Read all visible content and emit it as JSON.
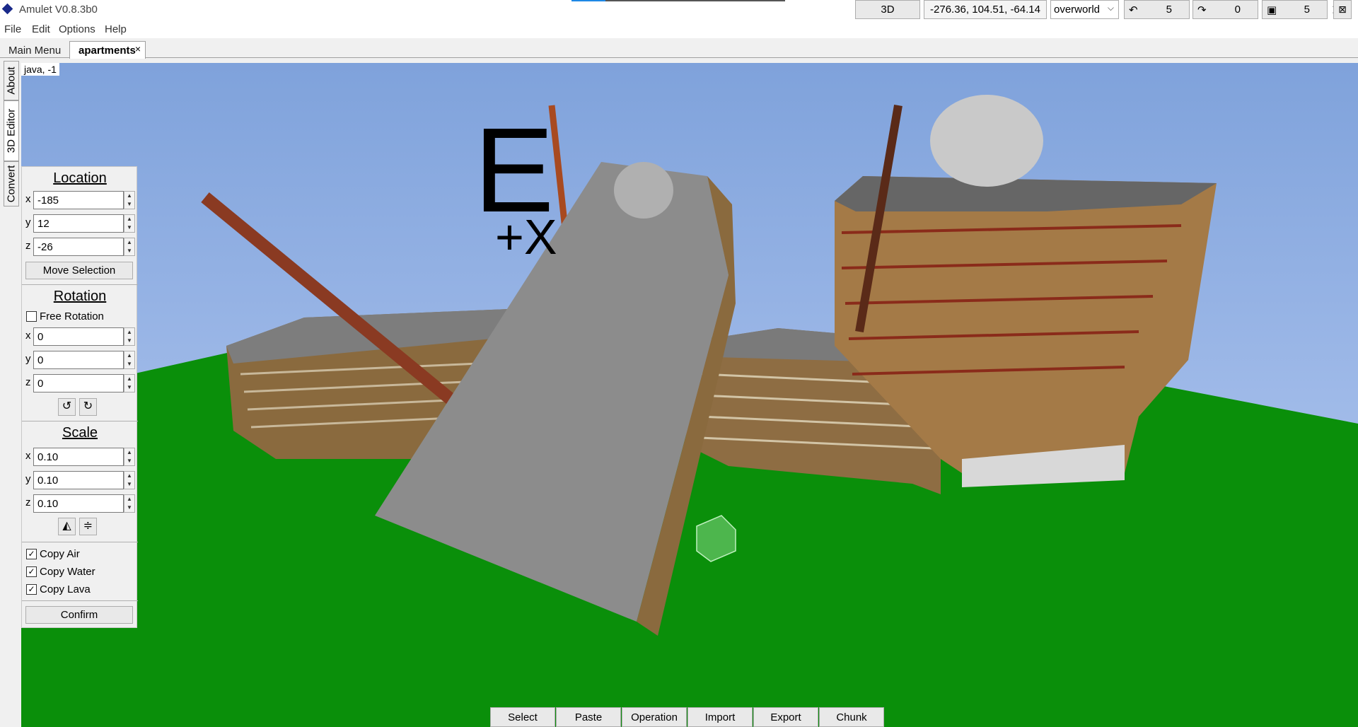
{
  "window": {
    "title": "Amulet V0.8.3b0",
    "progress_fraction": 0.16
  },
  "menu": [
    "File",
    "Edit",
    "Options",
    "Help"
  ],
  "tabs": {
    "main": "Main Menu",
    "active": "apartments",
    "close_glyph": "×"
  },
  "side_tabs": [
    "About",
    "3D Editor",
    "Convert"
  ],
  "viewport": {
    "dimension_label": "java, -1",
    "sky_color": "#8aaae0",
    "ground_color": "#0a8f0a"
  },
  "toolbar": {
    "view_mode": "3D",
    "coordinates": "-276.36, 104.51, -64.14",
    "dimension": "overworld",
    "undo_count": "5",
    "redo_count": "0",
    "save_count": "5"
  },
  "panel": {
    "location": {
      "title": "Location",
      "x": "-185",
      "y": "12",
      "z": "-26",
      "move_button": "Move Selection"
    },
    "rotation": {
      "title": "Rotation",
      "free_label": "Free Rotation",
      "free_checked": false,
      "x": "0",
      "y": "0",
      "z": "0"
    },
    "scale": {
      "title": "Scale",
      "x": "0.10",
      "y": "0.10",
      "z": "0.10"
    },
    "copy": {
      "air": "Copy Air",
      "water": "Copy Water",
      "lava": "Copy Lava"
    },
    "confirm": "Confirm"
  },
  "bottom_toolbar": [
    "Select",
    "Paste",
    "Operation",
    "Import",
    "Export",
    "Chunk"
  ],
  "scene": {
    "compass_letter": "E",
    "axis_label": "+X"
  }
}
